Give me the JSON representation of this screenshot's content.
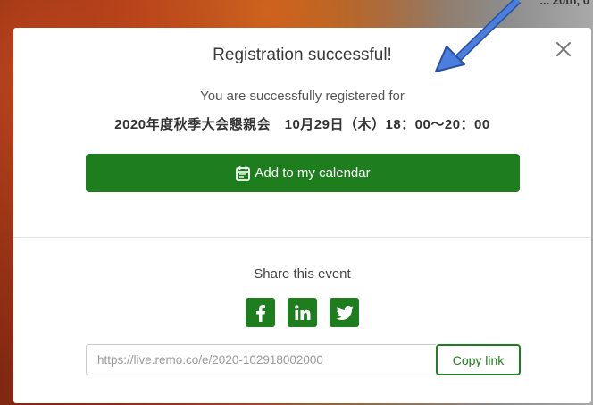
{
  "background": {
    "corner_text": "... 20th, 0"
  },
  "modal": {
    "title": "Registration successful!",
    "subtitle": "You are successfully registered for",
    "event": "2020年度秋季大会懇親会　10月29日（木）18：00〜20：00",
    "calendar_button": "Add to my calendar",
    "share_title": "Share this event",
    "socials": [
      "facebook-icon",
      "linkedin-icon",
      "twitter-icon"
    ],
    "link_value": "https://live.remo.co/e/2020-102918002000",
    "copy_button": "Copy link"
  },
  "colors": {
    "accent": "#1e7e1e",
    "arrow": "#3b6fd1"
  }
}
